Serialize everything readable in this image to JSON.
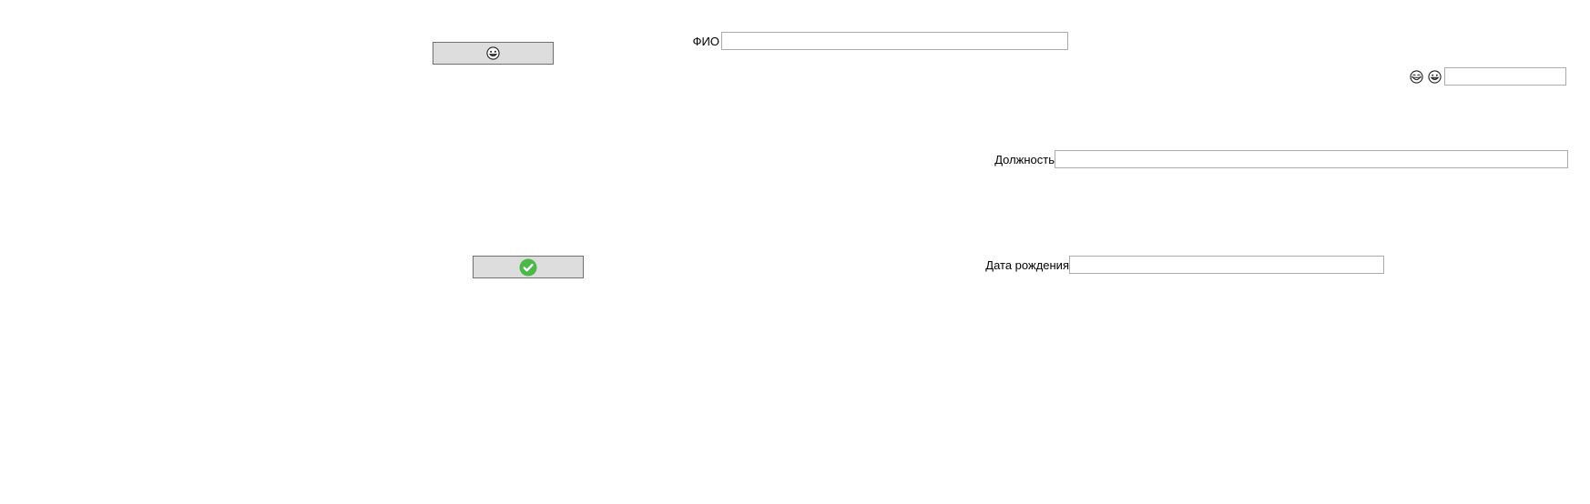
{
  "form": {
    "fio": {
      "label": "ФИО",
      "value": "",
      "placeholder": ""
    },
    "position": {
      "label": "Должность",
      "value": "",
      "placeholder": ""
    },
    "birth_date": {
      "label": "Дата рождения",
      "value": "",
      "placeholder": ""
    },
    "small_field": {
      "value": "",
      "placeholder": ""
    }
  },
  "buttons": {
    "emoji_button": {
      "icon": "smiley-face-icon"
    },
    "confirm_button": {
      "icon": "checkmark-icon",
      "color": "#4cb848"
    }
  },
  "icons": {
    "face_icon_1": "laughing-face-icon",
    "face_icon_2": "grinning-face-icon"
  }
}
